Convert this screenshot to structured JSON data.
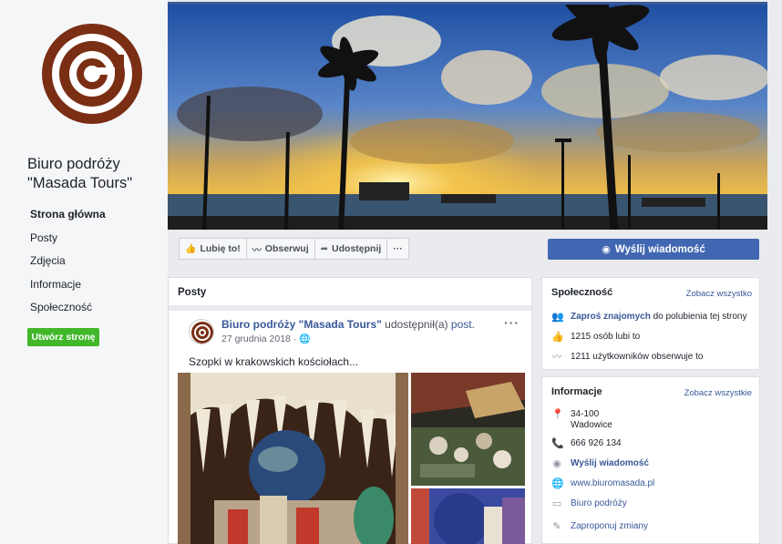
{
  "page": {
    "name_line1": "Biuro podróży",
    "name_line2": "\"Masada Tours\""
  },
  "nav": {
    "items": [
      "Strona główna",
      "Posty",
      "Zdjęcia",
      "Informacje",
      "Społeczność"
    ],
    "create_button": "Utwórz stronę"
  },
  "actions": {
    "like": "Lubię to!",
    "follow": "Obserwuj",
    "share": "Udostępnij",
    "more": "···",
    "send_message": "Wyślij wiadomość"
  },
  "posts": {
    "title": "Posty",
    "author": "Biuro podróży \"Masada Tours\"",
    "action": " udostępnił(a) ",
    "link": "post.",
    "date": "27 grudnia 2018 · ",
    "text": "Szopki w krakowskich kościołach...",
    "more": "···"
  },
  "community": {
    "title": "Społeczność",
    "see_all": "Zobacz wszystko",
    "invite_link": "Zaproś znajomych",
    "invite_rest": " do polubienia tej strony",
    "likes": "1215 osób lubi to",
    "follows": "1211 użytkowników obserwuje to"
  },
  "info": {
    "title": "Informacje",
    "see_all": "Zobacz wszystkie",
    "postal": "34-100",
    "city": "Wadowice",
    "phone": "666 926 134",
    "message": "Wyślij wiadomość",
    "website": "www.biuromasada.pl",
    "category": "Biuro podróży",
    "suggest": "Zaproponuj zmiany"
  },
  "colors": {
    "brand_blue": "#4267b2",
    "link_blue": "#385898",
    "create_green": "#42b72a",
    "logo_brown": "#7a2e14"
  }
}
